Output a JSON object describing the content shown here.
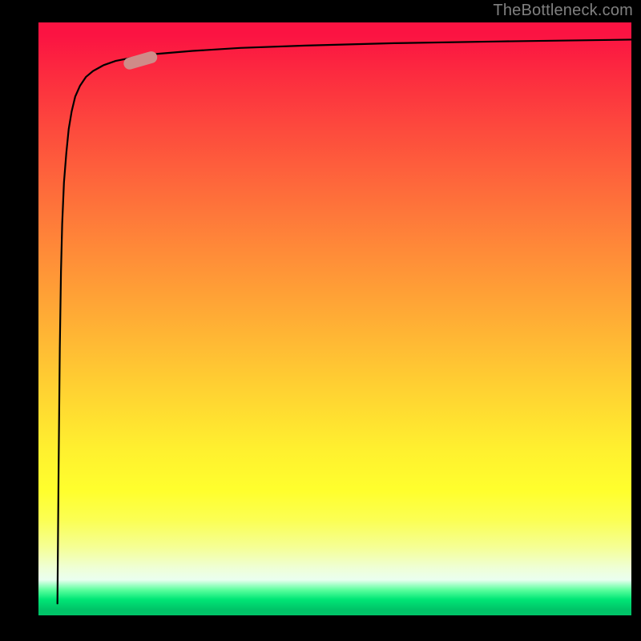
{
  "watermark": "TheBottleneck.com",
  "colors": {
    "page_bg": "#000000",
    "watermark_text": "#808080",
    "curve_stroke": "#000000",
    "marker_fill": "#cf8b88",
    "gradient_top": "#fb1342",
    "gradient_bottom": "#00c468"
  },
  "chart_data": {
    "type": "line",
    "title": "",
    "xlabel": "",
    "ylabel": "",
    "xlim": [
      0,
      100
    ],
    "ylim": [
      0,
      100
    ],
    "grid": false,
    "legend": false,
    "axes_visible": false,
    "series": [
      {
        "name": "bottleneck-curve",
        "x": [
          3.2,
          3.4,
          3.6,
          3.8,
          4.0,
          4.3,
          4.7,
          5.1,
          5.6,
          6.2,
          7.0,
          8.0,
          9.2,
          11,
          13,
          16,
          20,
          26,
          34,
          45,
          60,
          78,
          100
        ],
        "y": [
          2,
          25,
          45,
          58,
          66,
          73,
          78,
          82,
          85,
          87.5,
          89.3,
          90.8,
          91.8,
          92.8,
          93.5,
          94.1,
          94.7,
          95.2,
          95.7,
          96.1,
          96.5,
          96.8,
          97.1
        ]
      }
    ],
    "marker": {
      "x": 17.2,
      "y": 93.6,
      "length_pct": 5.8,
      "thickness_pct": 2.0,
      "angle_deg": -16
    },
    "notes": "Axes are unlabeled in the source image; values are normalized 0–100 and estimated from pixel positions against the plot area. The background encodes a vertical color scale from red (top, worst) to green (bottom, best)."
  }
}
